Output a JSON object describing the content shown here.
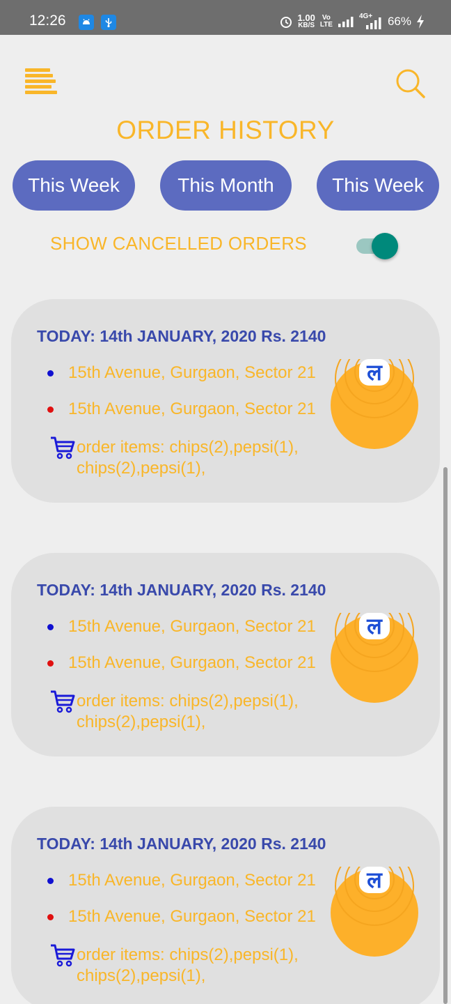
{
  "status_bar": {
    "time": "12:26",
    "speed_value": "1.00",
    "speed_unit": "KB/S",
    "volte_top": "Vo",
    "volte_bottom": "LTE",
    "network": "4G+",
    "battery": "66%"
  },
  "header": {
    "menu_icon": "menu-icon",
    "search_icon": "search-icon",
    "title": "ORDER HISTORY"
  },
  "filters": [
    {
      "label": "This Week"
    },
    {
      "label": "This Month"
    },
    {
      "label": "This Week"
    }
  ],
  "cancelled_toggle": {
    "label": "SHOW CANCELLED ORDERS",
    "on": true
  },
  "orders": [
    {
      "title": "TODAY: 14th JANUARY, 2020 Rs. 2140",
      "pickup": "15th Avenue, Gurgaon, Sector 21",
      "drop": "15th Avenue, Gurgaon, Sector 21",
      "items": "order items: chips(2),pepsi(1), chips(2),pepsi(1),",
      "logo_letter": "ल"
    },
    {
      "title": "TODAY: 14th JANUARY, 2020 Rs. 2140",
      "pickup": "15th Avenue, Gurgaon, Sector 21",
      "drop": "15th Avenue, Gurgaon, Sector 21",
      "items": "order items: chips(2),pepsi(1), chips(2),pepsi(1),",
      "logo_letter": "ल"
    },
    {
      "title": "TODAY: 14th JANUARY, 2020 Rs. 2140",
      "pickup": "15th Avenue, Gurgaon, Sector 21",
      "drop": "15th Avenue, Gurgaon, Sector 21",
      "items": "order items: chips(2),pepsi(1), chips(2),pepsi(1),",
      "logo_letter": "ल"
    }
  ],
  "colors": {
    "accent": "#f9b629",
    "chip": "#5c6bc0",
    "title_blue": "#3949ab",
    "toggle_on": "#00897b",
    "pickup_dot": "#1010d0",
    "drop_dot": "#e01010"
  }
}
